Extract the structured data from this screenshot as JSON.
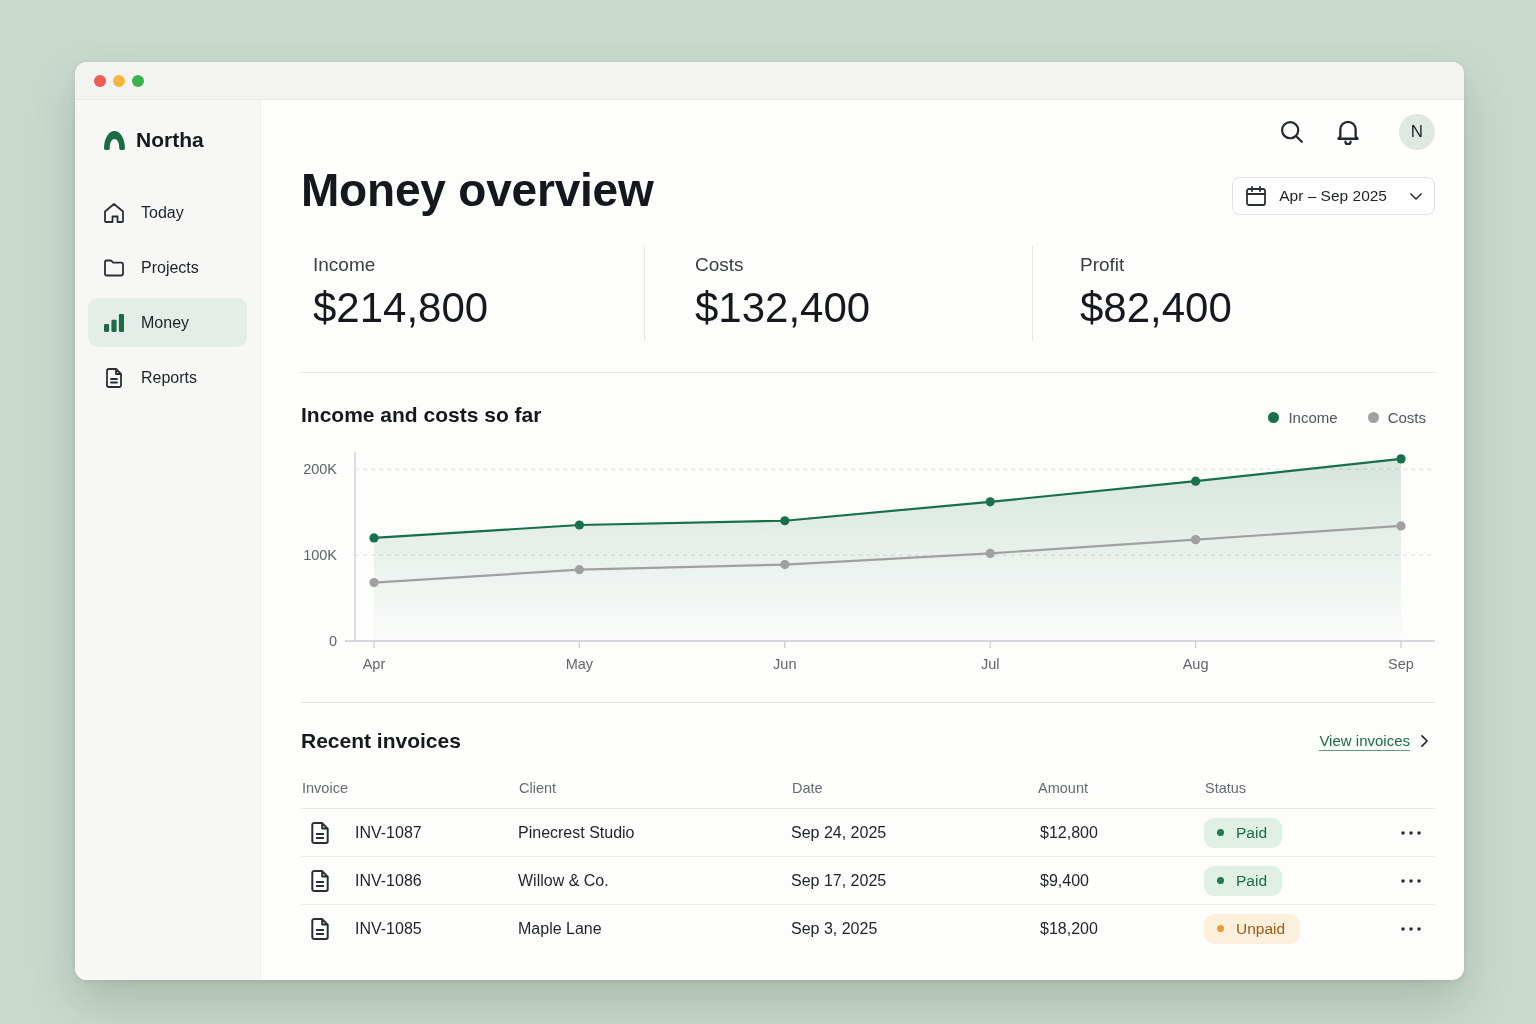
{
  "window": {
    "controls": [
      {
        "color": "#ed5e55"
      },
      {
        "color": "#f5b83d"
      },
      {
        "color": "#3ab54a"
      }
    ]
  },
  "sidebar": {
    "brand": "Northa",
    "items": [
      {
        "label": "Today",
        "selected": false
      },
      {
        "label": "Projects",
        "selected": false
      },
      {
        "label": "Money",
        "selected": true
      },
      {
        "label": "Reports",
        "selected": false
      }
    ]
  },
  "topbar": {
    "avatar": "N"
  },
  "page": {
    "title": "Money overview",
    "date_range": "Apr – Sep 2025"
  },
  "stats": [
    {
      "label": "Income",
      "value": "$214,800"
    },
    {
      "label": "Costs",
      "value": "$132,400"
    },
    {
      "label": "Profit",
      "value": "$82,400"
    }
  ],
  "chart": {
    "title": "Income and costs so far",
    "chart_data": {
      "type": "line",
      "categories": [
        "Apr",
        "May",
        "Jun",
        "Jul",
        "Aug",
        "Sep"
      ],
      "series": [
        {
          "name": "Income",
          "type": "area",
          "color": "#17704a",
          "marker": "circle",
          "values": [
            120000,
            135000,
            140000,
            162000,
            186000,
            212000
          ]
        },
        {
          "name": "Costs",
          "color": "#a0a0a0",
          "marker": "circle",
          "values": [
            68000,
            83000,
            89000,
            102000,
            118000,
            134000
          ]
        }
      ],
      "ylim": [
        0,
        220000
      ],
      "yticks": [
        {
          "value": 0,
          "label": "0"
        },
        {
          "value": 100000,
          "label": "100K"
        },
        {
          "value": 200000,
          "label": "200K"
        }
      ]
    }
  },
  "invoices": {
    "title": "Recent invoices",
    "link": "View invoices",
    "columns": [
      "Invoice",
      "Client",
      "Date",
      "Amount",
      "Status"
    ],
    "rows": [
      {
        "invoice": "INV-1087",
        "client": "Pinecrest Studio",
        "date": "Sep 24, 2025",
        "amount": "$12,800",
        "status": {
          "label": "Paid",
          "kind": "paid"
        }
      },
      {
        "invoice": "INV-1086",
        "client": "Willow & Co.",
        "date": "Sep 17, 2025",
        "amount": "$9,400",
        "status": {
          "label": "Paid",
          "kind": "paid"
        }
      },
      {
        "invoice": "INV-1085",
        "client": "Maple Lane",
        "date": "Sep 3, 2025",
        "amount": "$18,200",
        "status": {
          "label": "Unpaid",
          "kind": "unpaid"
        }
      }
    ]
  }
}
